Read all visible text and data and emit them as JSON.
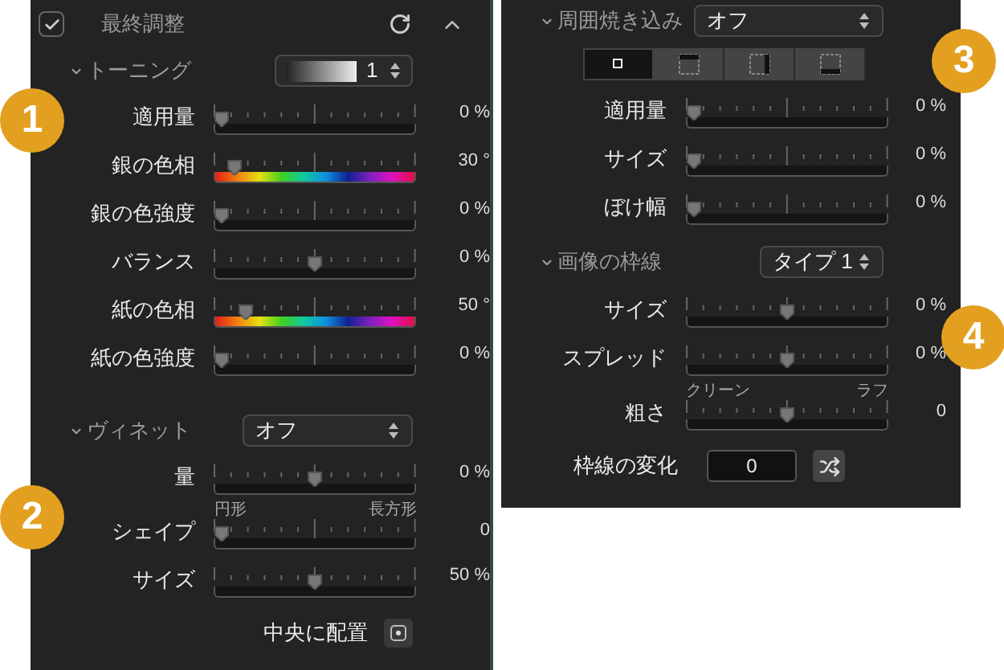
{
  "left_panel": {
    "header": {
      "checked": true,
      "title": "最終調整"
    },
    "toning": {
      "title": "トーニング",
      "expanded": true,
      "preset": "1"
    },
    "toning_sliders": [
      {
        "label": "適用量",
        "kind": "plain",
        "level": 0,
        "reading": "0 %"
      },
      {
        "label": "銀の色相",
        "kind": "hue",
        "level": 0.07,
        "reading": "30 °"
      },
      {
        "label": "銀の色強度",
        "kind": "plain",
        "level": 0,
        "reading": "0 %"
      },
      {
        "label": "バランス",
        "kind": "plain",
        "level": 0.5,
        "reading": "0 %"
      },
      {
        "label": "紙の色相",
        "kind": "hue",
        "level": 0.13,
        "reading": "50 °"
      },
      {
        "label": "紙の色強度",
        "kind": "plain",
        "level": 0,
        "reading": "0 %"
      }
    ],
    "vignette": {
      "title": "ヴィネット",
      "expanded": true,
      "value": "オフ"
    },
    "vignette_sliders": [
      {
        "label": "量",
        "kind": "plain",
        "level": 0.5,
        "reading": "0 %"
      },
      {
        "label": "シェイプ",
        "kind": "plain",
        "level": 0,
        "reading": "0",
        "min_label": "円形",
        "max_label": "長方形"
      },
      {
        "label": "サイズ",
        "kind": "plain",
        "level": 0.5,
        "reading": "50 %"
      }
    ],
    "center_label": "中央に配置"
  },
  "right_panel": {
    "burn": {
      "title": "周囲焼き込み",
      "expanded": true,
      "value": "オフ"
    },
    "burn_modes": [
      {
        "kind": "center",
        "selected": true
      },
      {
        "kind": "top",
        "selected": false
      },
      {
        "kind": "right",
        "selected": false
      },
      {
        "kind": "bottom",
        "selected": false
      }
    ],
    "burn_sliders": [
      {
        "label": "適用量",
        "kind": "plain",
        "level": 0,
        "reading": "0 %"
      },
      {
        "label": "サイズ",
        "kind": "plain",
        "level": 0,
        "reading": "0 %"
      },
      {
        "label": "ぼけ幅",
        "kind": "plain",
        "level": 0,
        "reading": "0 %"
      }
    ],
    "border": {
      "title": "画像の枠線",
      "expanded": true,
      "value": "タイプ 1"
    },
    "border_sliders": [
      {
        "label": "サイズ",
        "kind": "plain",
        "level": 0.5,
        "reading": "0 %"
      },
      {
        "label": "スプレッド",
        "kind": "plain",
        "level": 0.5,
        "reading": "0 %"
      },
      {
        "label": "粗さ",
        "kind": "plain",
        "level": 0.5,
        "reading": "0",
        "min_label": "クリーン",
        "max_label": "ラフ"
      }
    ],
    "variation": {
      "label": "枠線の変化",
      "value": "0"
    }
  },
  "callouts": [
    "1",
    "2",
    "3",
    "4"
  ]
}
